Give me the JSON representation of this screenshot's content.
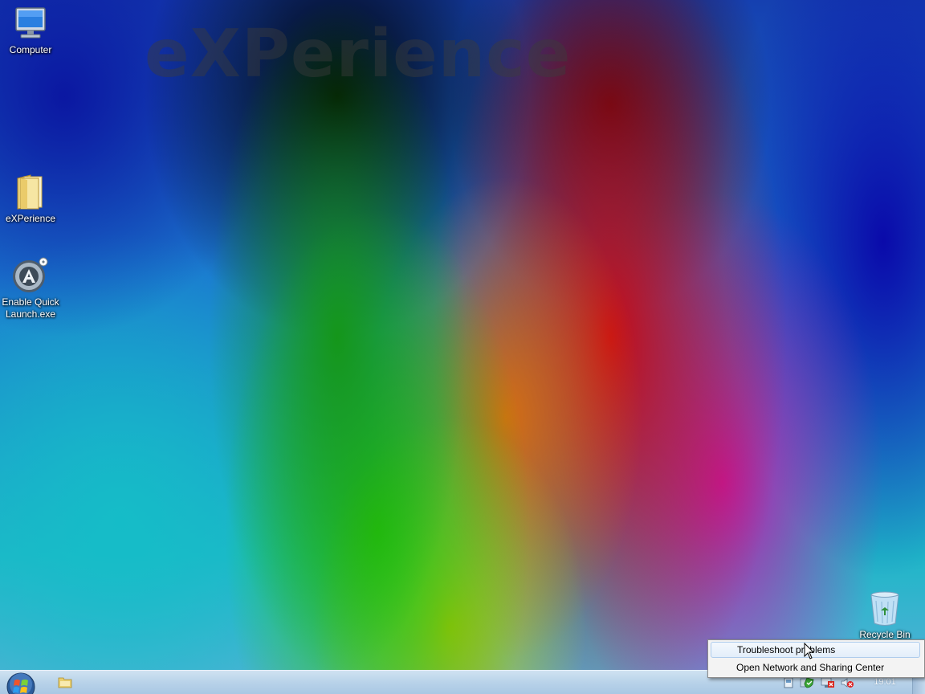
{
  "wallpaper": {
    "watermark": "eXPerience"
  },
  "desktop_icons": {
    "computer": {
      "label": "Computer",
      "icon": "computer-icon"
    },
    "experience": {
      "label": "eXPerience",
      "icon": "folder-icon"
    },
    "quick_launch": {
      "label": "Enable Quick Launch.exe",
      "icon": "app-exe-icon"
    },
    "recycle_bin": {
      "label": "Recycle Bin",
      "icon": "recycle-bin-icon"
    }
  },
  "context_menu": {
    "items": [
      {
        "label": "Troubleshoot problems",
        "highlighted": true
      },
      {
        "label": "Open Network and Sharing Center",
        "highlighted": false
      }
    ]
  },
  "taskbar": {
    "start_icon": "windows-start-orb",
    "pinned": [
      {
        "icon": "explorer-folder-icon"
      }
    ],
    "tray_icons": [
      "action-center-flag-icon",
      "security-shield-icon",
      "network-icon",
      "volume-muted-icon"
    ],
    "clock": "19:01"
  },
  "colors": {
    "taskbar": "#b8d2e9",
    "menu_background": "#f3f3f3",
    "menu_highlight_border": "#aeccec",
    "mute_x": "#e02020"
  }
}
